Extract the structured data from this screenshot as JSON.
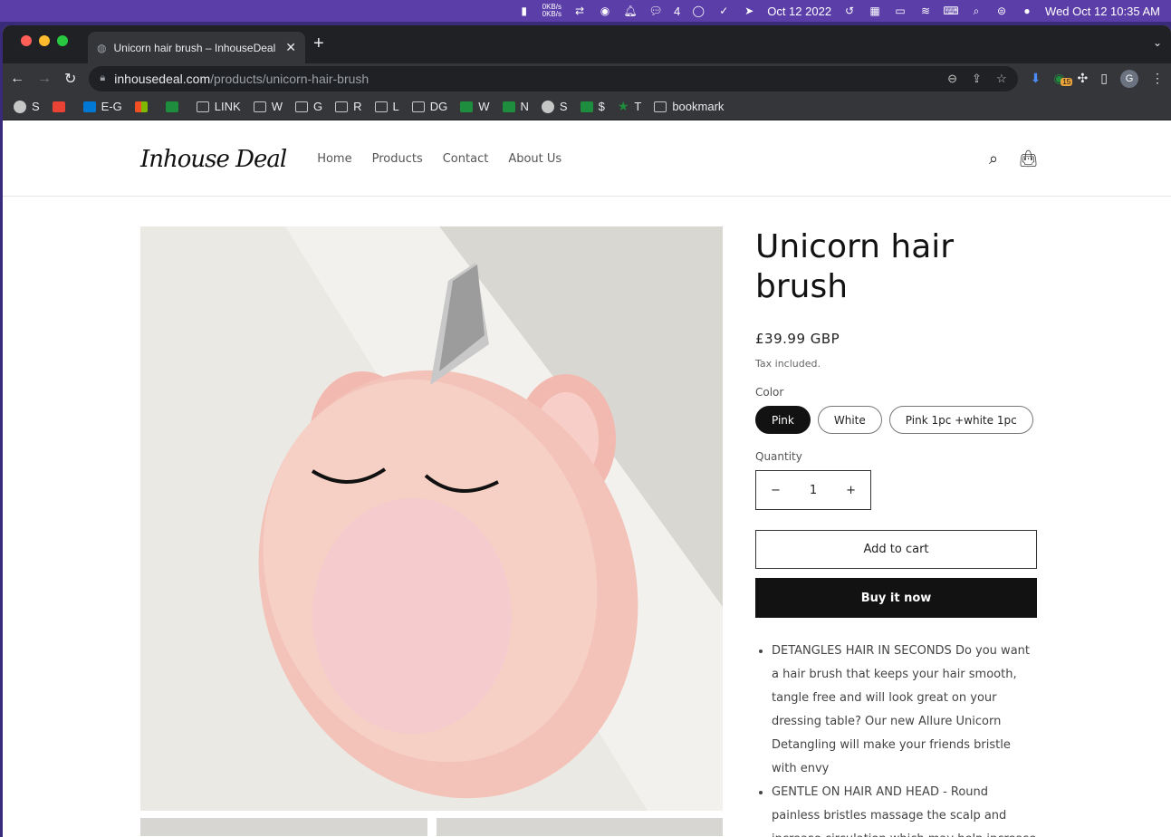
{
  "menubar": {
    "net_up": "0KB/s",
    "net_down": "0KB/s",
    "wechat_count": "4",
    "date_label": "Oct 12 2022",
    "clock": "Wed Oct 12  10:35 AM"
  },
  "browser": {
    "tab_title": "Unicorn hair brush – InhouseDeal",
    "url_domain": "inhousedeal.com",
    "url_path": "/products/unicorn-hair-brush",
    "ext_badge": "15",
    "profile_initial": "G",
    "bookmarks": [
      {
        "icon": "globe-icon",
        "label": "S"
      },
      {
        "icon": "gmail-icon",
        "label": ""
      },
      {
        "icon": "outlook-icon",
        "label": "E-G"
      },
      {
        "icon": "microsoft-icon",
        "label": ""
      },
      {
        "icon": "grammarly-icon",
        "label": ""
      },
      {
        "icon": "folder-icon",
        "label": "LINK"
      },
      {
        "icon": "folder-icon",
        "label": "W"
      },
      {
        "icon": "folder-icon",
        "label": "G"
      },
      {
        "icon": "folder-icon",
        "label": "R"
      },
      {
        "icon": "folder-icon",
        "label": "L"
      },
      {
        "icon": "folder-icon",
        "label": "DG"
      },
      {
        "icon": "sheets-icon",
        "label": "W"
      },
      {
        "icon": "sheets-icon",
        "label": "N"
      },
      {
        "icon": "globe-icon",
        "label": "S"
      },
      {
        "icon": "sheets-icon",
        "label": "$"
      },
      {
        "icon": "star-icon",
        "label": "T"
      },
      {
        "icon": "folder-icon",
        "label": "bookmark"
      }
    ]
  },
  "site": {
    "logo": "Inhouse Deal",
    "nav": [
      "Home",
      "Products",
      "Contact",
      "About Us"
    ]
  },
  "product": {
    "title": "Unicorn hair brush",
    "price": "£39.99 GBP",
    "tax_note": "Tax included.",
    "color_label": "Color",
    "colors": [
      "Pink",
      "White",
      "Pink 1pc +white 1pc"
    ],
    "selected_color": "Pink",
    "quantity_label": "Quantity",
    "quantity": "1",
    "add_to_cart": "Add to cart",
    "buy_now": "Buy it now",
    "description": [
      "DETANGLES HAIR IN SECONDS Do you want a hair brush that keeps your hair smooth, tangle free and will look great on your dressing table? Our new Allure Unicorn Detangling will make your friends bristle with envy",
      "GENTLE ON HAIR AND HEAD - Round painless bristles massage the scalp and increase circulation which may help increase hair"
    ]
  }
}
